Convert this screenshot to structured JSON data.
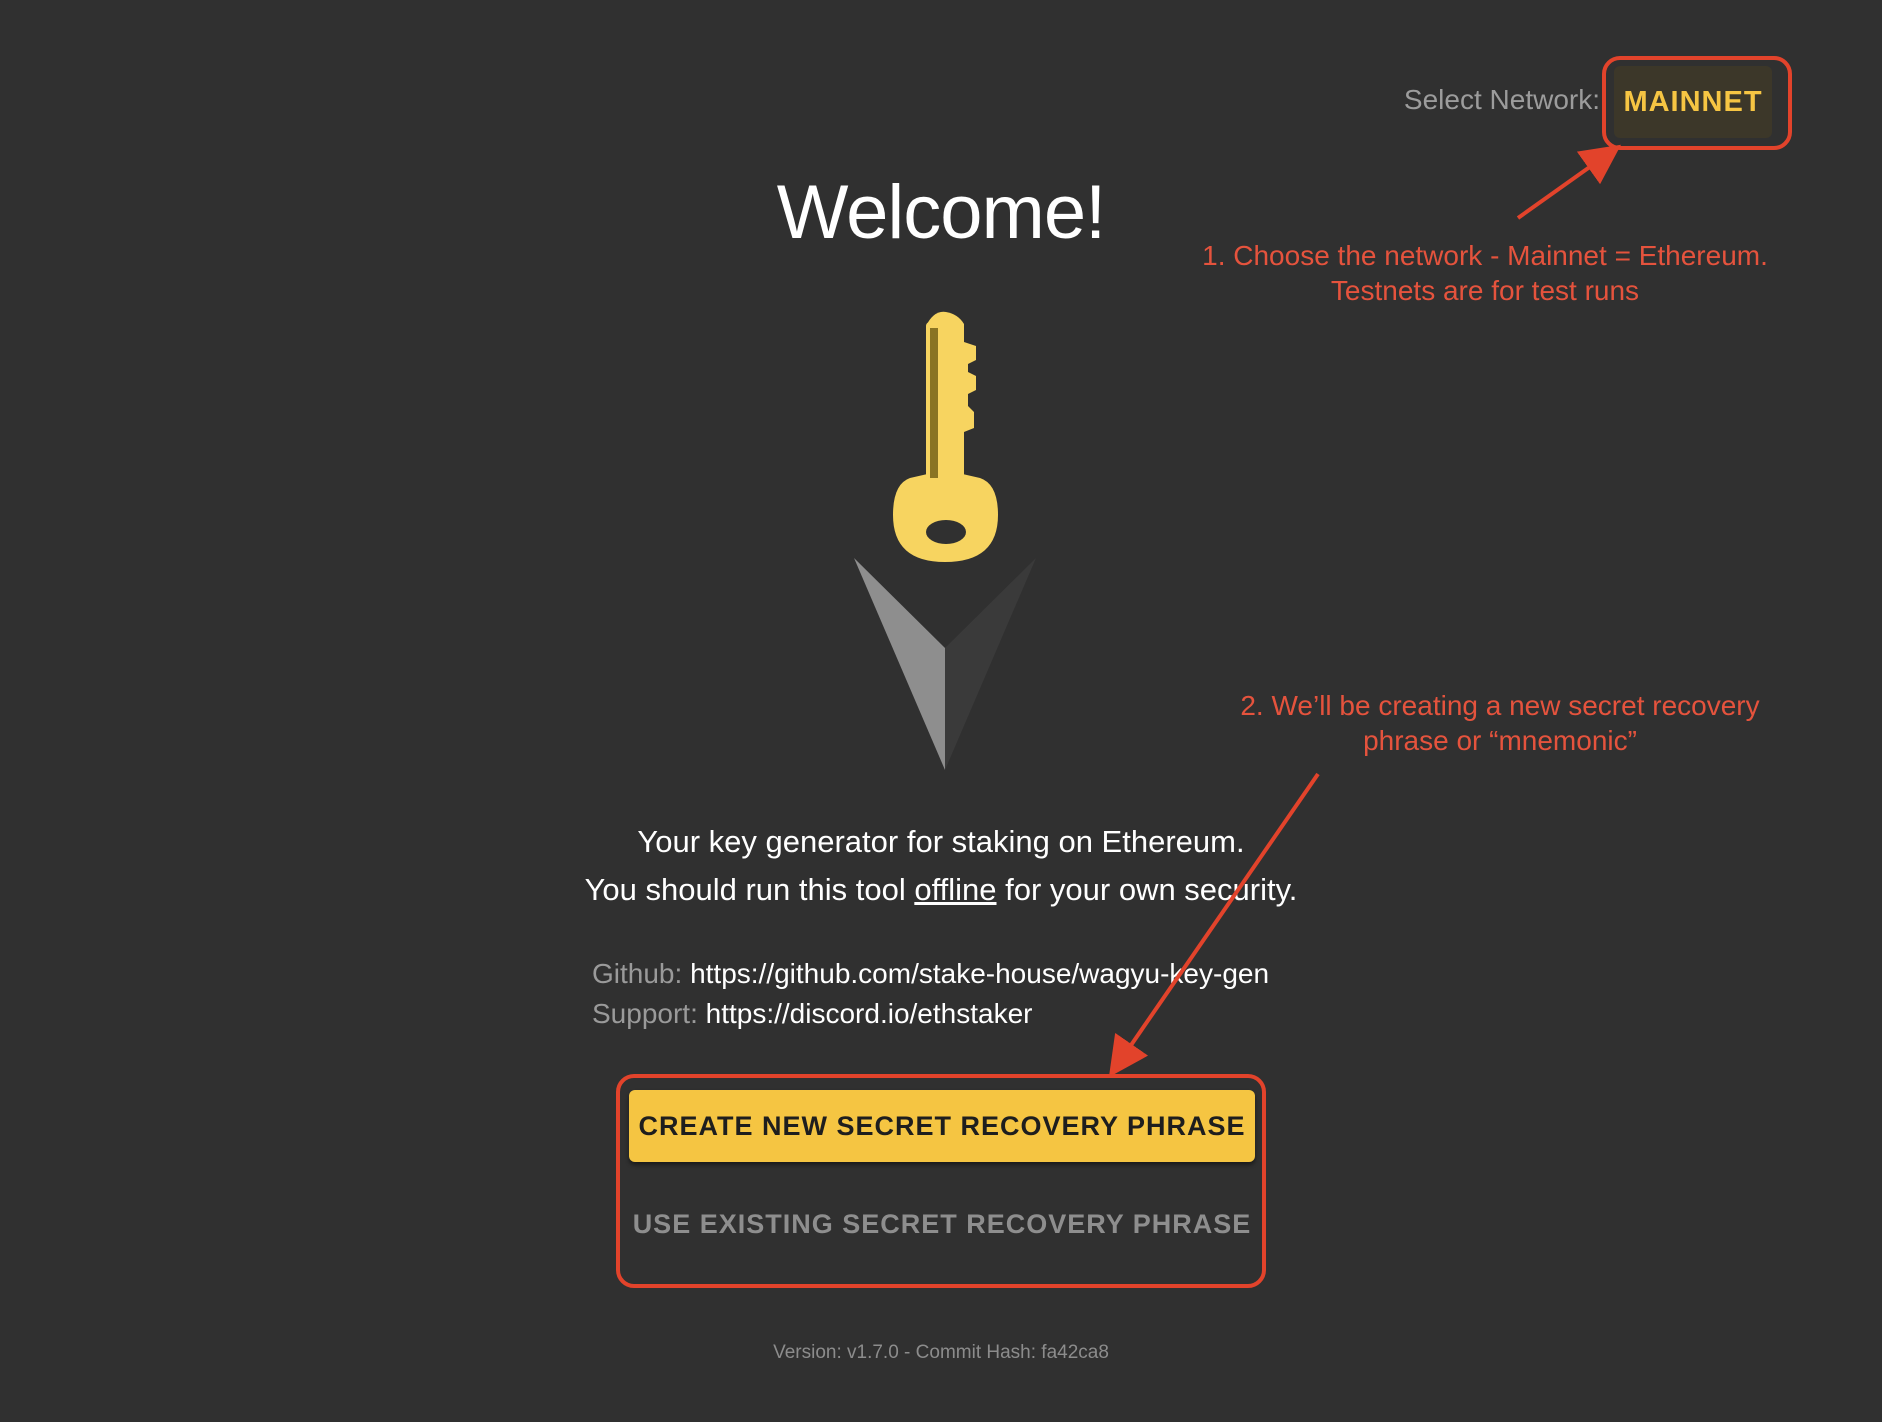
{
  "header": {
    "network_label": "Select Network:",
    "network_value": "MAINNET"
  },
  "main": {
    "title": "Welcome!",
    "tagline": {
      "line1": "Your key generator for staking on Ethereum.",
      "line2_before": "You should run this tool ",
      "line2_link": "offline",
      "line2_after": " for your own security."
    },
    "links": {
      "github_label": "Github:",
      "github_url": "https://github.com/stake-house/wagyu-key-gen",
      "support_label": "Support:",
      "support_url": "https://discord.io/ethstaker"
    },
    "buttons": {
      "create": "CREATE NEW SECRET RECOVERY PHRASE",
      "use_existing": "USE EXISTING SECRET RECOVERY PHRASE"
    }
  },
  "footer": {
    "version": "Version: v1.7.0 - Commit Hash: fa42ca8"
  },
  "annotations": {
    "note1_line1": "1. Choose the network - Mainnet = Ethereum.",
    "note1_line2": "Testnets are for test runs",
    "note2_line1": "2. We’ll be creating a new secret recovery",
    "note2_line2": "phrase or “mnemonic”"
  },
  "colors": {
    "background": "#303030",
    "accent": "#f5c542",
    "annotation": "#e2432b"
  },
  "icons": {
    "logo": "key-icon"
  }
}
